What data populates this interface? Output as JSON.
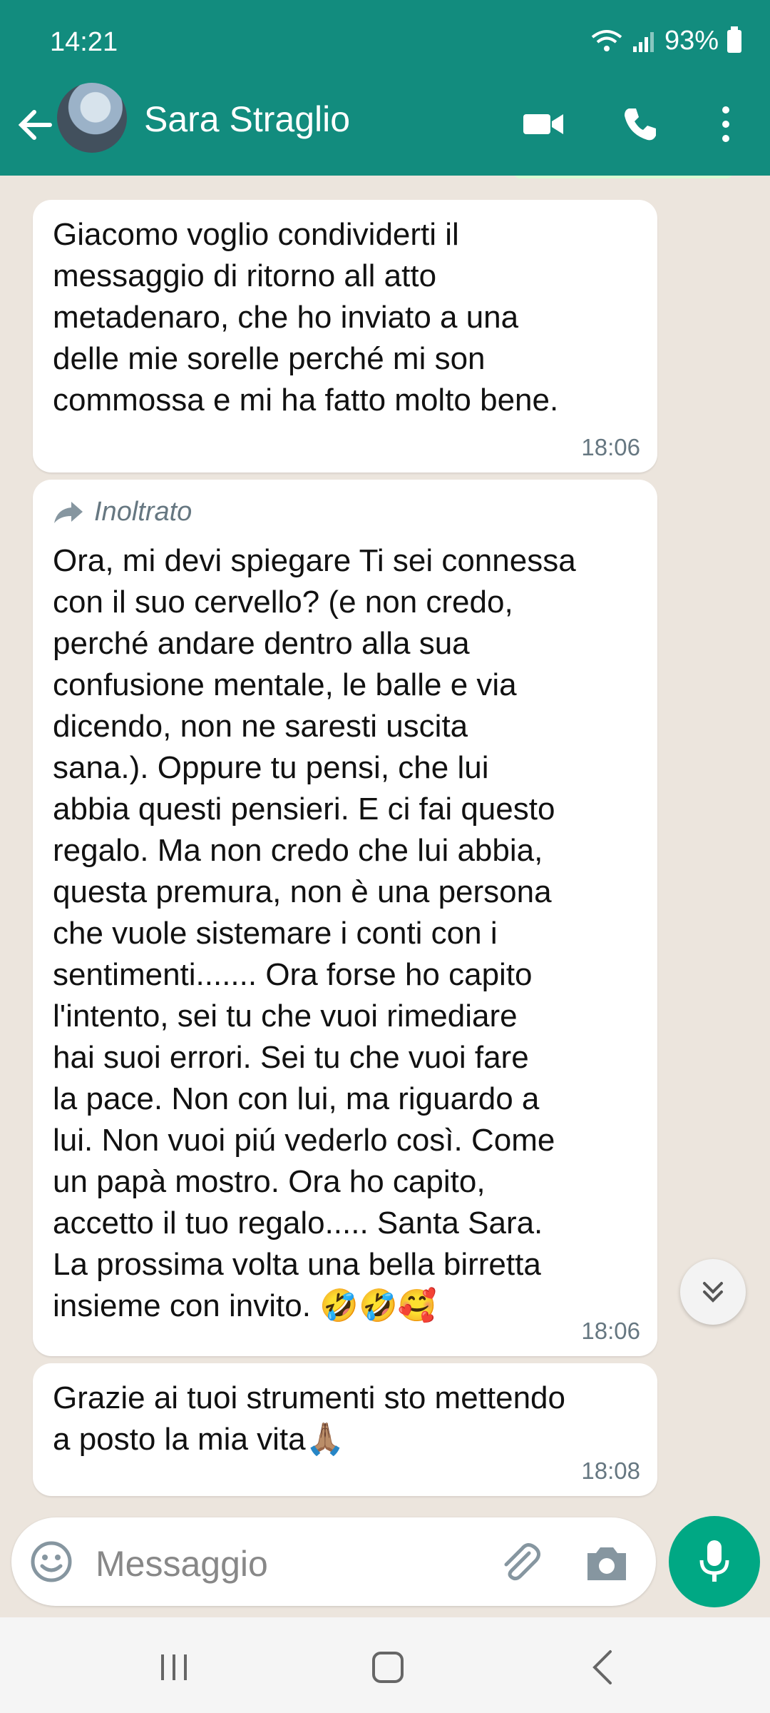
{
  "status_bar": {
    "time": "14:21",
    "battery": "93%"
  },
  "header": {
    "contact_name": "Sara Straglio"
  },
  "messages": [
    {
      "text": "Giacomo voglio condividerti il\nmessaggio di ritorno all atto\nmetadenaro, che ho inviato a una\ndelle mie sorelle perché mi son\ncommossa e mi ha fatto molto bene.",
      "time": "18:06"
    },
    {
      "forwarded_label": "Inoltrato",
      "text": "Ora, mi devi spiegare Ti sei connessa\ncon il suo cervello? (e non credo,\nperché andare dentro alla sua\nconfusione mentale, le balle e via\ndicendo, non ne saresti uscita\nsana.). Oppure tu pensi, che lui\nabbia questi pensieri. E ci fai questo\nregalo. Ma non credo che lui abbia,\nquesta premura, non è una persona\nche vuole sistemare i conti con i\nsentimenti....... Ora forse ho capito\nl'intento, sei tu  che vuoi rimediare\nhai suoi errori. Sei tu che vuoi fare\nla pace. Non con lui, ma riguardo a\nlui. Non vuoi piú vederlo così. Come\nun papà mostro. Ora ho capito,\naccetto il tuo regalo.....  Santa Sara.\nLa prossima volta una bella birretta\ninsieme con invito. 🤣🤣🥰",
      "time": "18:06"
    },
    {
      "text": "Grazie ai tuoi strumenti sto mettendo\na posto la mia vita🙏🏽",
      "time": "18:08"
    }
  ],
  "composer": {
    "placeholder": "Messaggio"
  },
  "icons": {
    "header": [
      "back-arrow-icon",
      "avatar",
      "video-call-icon",
      "voice-call-icon",
      "more-options-icon"
    ],
    "composer": [
      "emoji-icon",
      "attach-icon",
      "camera-icon",
      "mic-icon"
    ],
    "navigation": [
      "recent-apps-icon",
      "home-icon",
      "back-icon"
    ],
    "chat": [
      "forward-arrow-icon",
      "scroll-down-icon"
    ]
  },
  "colors": {
    "header": "#128c7e",
    "accent": "#00a884",
    "chat_bg": "#ece5dd"
  }
}
